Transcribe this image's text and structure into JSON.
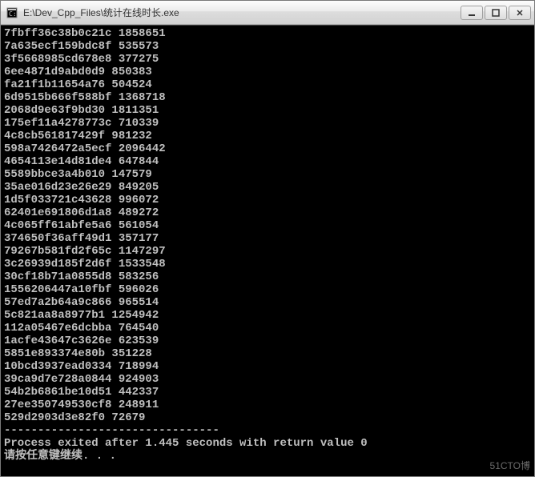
{
  "window": {
    "title": "E:\\Dev_Cpp_Files\\统计在线时长.exe"
  },
  "console": {
    "rows": [
      {
        "hash": "7fbff36c38b0c21c",
        "value": "1858651"
      },
      {
        "hash": "7a635ecf159bdc8f",
        "value": "535573"
      },
      {
        "hash": "3f5668985cd678e8",
        "value": "377275"
      },
      {
        "hash": "6ee4871d9abd0d9",
        "value": "850383"
      },
      {
        "hash": "fa21f1b11654a76",
        "value": "504524"
      },
      {
        "hash": "6d9515b666f588bf",
        "value": "1368718"
      },
      {
        "hash": "2068d9e63f9bd30",
        "value": "1811351"
      },
      {
        "hash": "175ef11a4278773c",
        "value": "710339"
      },
      {
        "hash": "4c8cb561817429f",
        "value": "981232"
      },
      {
        "hash": "598a7426472a5ecf",
        "value": "2096442"
      },
      {
        "hash": "4654113e14d81de4",
        "value": "647844"
      },
      {
        "hash": "5589bbce3a4b010",
        "value": "147579"
      },
      {
        "hash": "35ae016d23e26e29",
        "value": "849205"
      },
      {
        "hash": "1d5f033721c43628",
        "value": "996072"
      },
      {
        "hash": "62401e691806d1a8",
        "value": "489272"
      },
      {
        "hash": "4c065ff61abfe5a6",
        "value": "561054"
      },
      {
        "hash": "374650f36aff49d1",
        "value": "357177"
      },
      {
        "hash": "79267b581fd2f65c",
        "value": "1147297"
      },
      {
        "hash": "3c26939d185f2d6f",
        "value": "1533548"
      },
      {
        "hash": "30cf18b71a0855d8",
        "value": "583256"
      },
      {
        "hash": "1556206447a10fbf",
        "value": "596026"
      },
      {
        "hash": "57ed7a2b64a9c866",
        "value": "965514"
      },
      {
        "hash": "5c821aa8a8977b1",
        "value": "1254942"
      },
      {
        "hash": "112a05467e6dcbba",
        "value": "764540"
      },
      {
        "hash": "1acfe43647c3626e",
        "value": "623539"
      },
      {
        "hash": "5851e893374e80b",
        "value": "351228"
      },
      {
        "hash": "10bcd3937ead0334",
        "value": "718994"
      },
      {
        "hash": "39ca9d7e728a0844",
        "value": "924903"
      },
      {
        "hash": "54b2b6861be10d51",
        "value": "442337"
      },
      {
        "hash": "27ee350749530cf8",
        "value": "248911"
      },
      {
        "hash": "529d2903d3e82f0",
        "value": "72679"
      }
    ],
    "separator": "--------------------------------",
    "exit_message": "Process exited after 1.445 seconds with return value 0",
    "prompt": "请按任意键继续. . ."
  },
  "watermark": "51CTO博"
}
